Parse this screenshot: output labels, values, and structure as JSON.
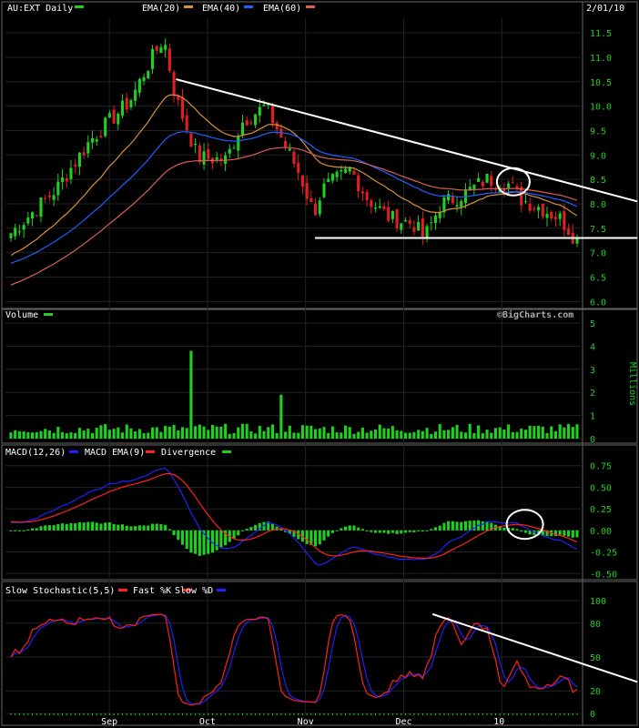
{
  "chart_data": [
    {
      "type": "candlestick",
      "panel": "price",
      "symbol_label": "AU:EXT Daily",
      "date_label": "2/01/10",
      "legend": [
        {
          "name": "EMA(20)",
          "color": "#d8913a"
        },
        {
          "name": "EMA(40)",
          "color": "#d8913a"
        },
        {
          "name": "EMA(60)",
          "color": "#d86050"
        }
      ],
      "series_labels": [
        "EMA(20)",
        "EMA(40)",
        "EMA(60)"
      ],
      "yticks": [
        "11.5",
        "11.0",
        "10.5",
        "10.0",
        "9.5",
        "9.0",
        "8.5",
        "8.0",
        "7.5",
        "7.0",
        "6.5",
        "6.0"
      ],
      "ylim": [
        5.95,
        11.8
      ],
      "candle_count": 133,
      "close_start": 7.4,
      "close_peak": 11.4,
      "close_end": 7.25,
      "trendline": {
        "from": [
          0.27,
          10.55
        ],
        "to": [
          1.0,
          8.05
        ],
        "color": "#ffffff"
      },
      "support": {
        "value": 7.3,
        "from": 0.49,
        "color": "#ffffff"
      },
      "circle": {
        "x": 0.88,
        "y": 8.45
      }
    },
    {
      "type": "bar",
      "panel": "volume",
      "title": "Volume",
      "watermark": "©BigCharts.com",
      "ylabel": "Millions",
      "yticks": [
        "5",
        "4",
        "3",
        "2",
        "1",
        "0"
      ],
      "ylim": [
        0,
        5
      ],
      "spikes": [
        {
          "i": 42,
          "value": 3.8
        },
        {
          "i": 63,
          "value": 1.9
        }
      ]
    },
    {
      "type": "line",
      "panel": "macd",
      "title": "MACD(12,26)",
      "legend": [
        {
          "name": "MACD EMA(9)",
          "color": "#2020ff"
        },
        {
          "name": "Divergence",
          "color": "#ff2020"
        }
      ],
      "yticks": [
        "0.75",
        "0.50",
        "0.25",
        "0.00",
        "-0.25",
        "-0.50"
      ],
      "ylim": [
        -0.55,
        0.8
      ]
    },
    {
      "type": "line",
      "panel": "stochastic",
      "title": "Slow Stochastic(5,5)",
      "legend": [
        {
          "name": "Fast %K",
          "color": "#ff2020"
        },
        {
          "name": "Slow %D",
          "color": "#2020ff"
        }
      ],
      "yticks": [
        "100",
        "80",
        "50",
        "20",
        "0"
      ],
      "ylim": [
        0,
        100
      ],
      "xticks": [
        "Sep",
        "Oct",
        "Nov",
        "Dec",
        "10"
      ]
    }
  ]
}
